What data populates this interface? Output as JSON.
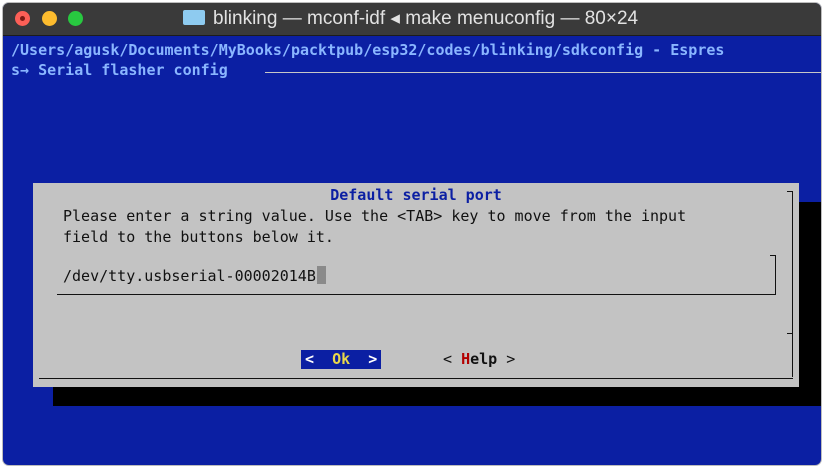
{
  "window": {
    "title": "blinking — mconf-idf ◂ make menuconfig — 80×24",
    "folder_icon": "folder-icon"
  },
  "terminal": {
    "config_path": "/Users/agusk/Documents/MyBooks/packtpub/esp32/codes/blinking/sdkconfig - Espres",
    "breadcrumb": "s→ Serial flasher config"
  },
  "dialog": {
    "title": "Default serial port",
    "prompt_line1": "Please enter a string value. Use the <TAB> key to move from the input",
    "prompt_line2": "field to the buttons below it.",
    "input_value": "/dev/tty.usbserial-00002014B"
  },
  "buttons": {
    "ok_left": "<",
    "ok_hot": "Ok",
    "ok_right": ">",
    "help_left": "< ",
    "help_hot": "H",
    "help_rest": "elp",
    "help_right": " >"
  },
  "colors": {
    "terminal_bg": "#0b1fa3",
    "dialog_bg": "#c3c3c3",
    "selected_button_bg": "#0b1fa3",
    "hotkey_selected": "#e9d84a",
    "hotkey": "#b30000"
  }
}
